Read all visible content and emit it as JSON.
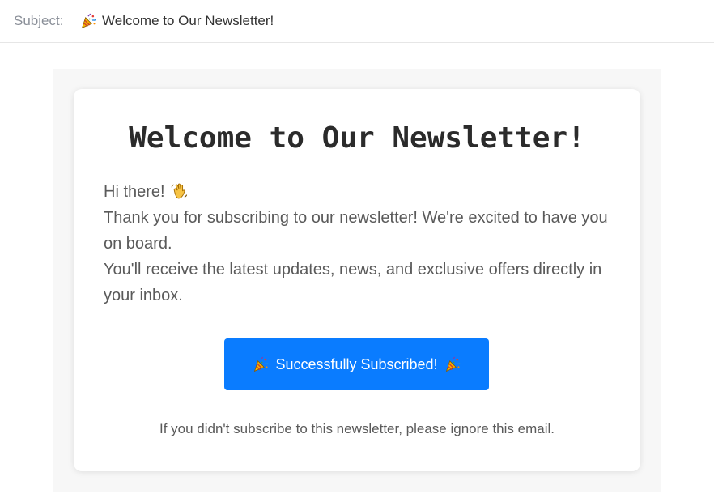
{
  "header": {
    "subject_label": "Subject:",
    "subject_icon": "party-popper-icon",
    "subject_text": "Welcome to Our Newsletter!"
  },
  "email": {
    "title": "Welcome to Our Newsletter!",
    "greeting": "Hi there!",
    "greeting_icon": "waving-hand-icon",
    "paragraph_1": "Thank you for subscribing to our newsletter! We're excited to have you on board.",
    "paragraph_2": "You'll receive the latest updates, news, and exclusive offers directly in your inbox.",
    "button_label": "Successfully Subscribed!",
    "button_icon": "party-popper-icon",
    "footer_note": "If you didn't subscribe to this newsletter, please ignore this email."
  },
  "colors": {
    "button": "#0a7cff",
    "card_background": "#ffffff",
    "page_background": "#f7f7f7",
    "title_text": "#2b2b2b",
    "body_text": "#5a5a5a",
    "subject_label": "#8a8f98"
  }
}
